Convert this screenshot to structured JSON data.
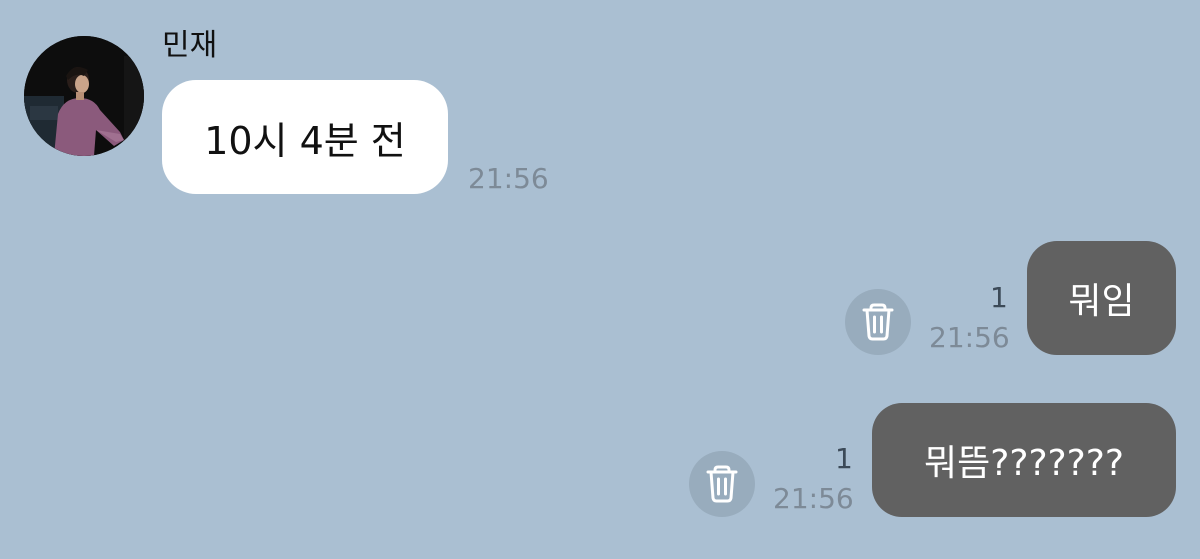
{
  "conversation": {
    "incoming": {
      "sender_name": "민재",
      "message": "10시 4분 전",
      "time": "21:56"
    },
    "outgoing": [
      {
        "message": "뭐임",
        "unread_count": "1",
        "time": "21:56",
        "action_icon": "trash-icon"
      },
      {
        "message": "뭐뜸???????",
        "unread_count": "1",
        "time": "21:56",
        "action_icon": "trash-icon"
      }
    ]
  },
  "colors": {
    "background": "#aabfd2",
    "incoming_bubble": "#ffffff",
    "outgoing_bubble": "#616161",
    "timestamp": "#7d8a97",
    "action_button": "#98acbd"
  }
}
